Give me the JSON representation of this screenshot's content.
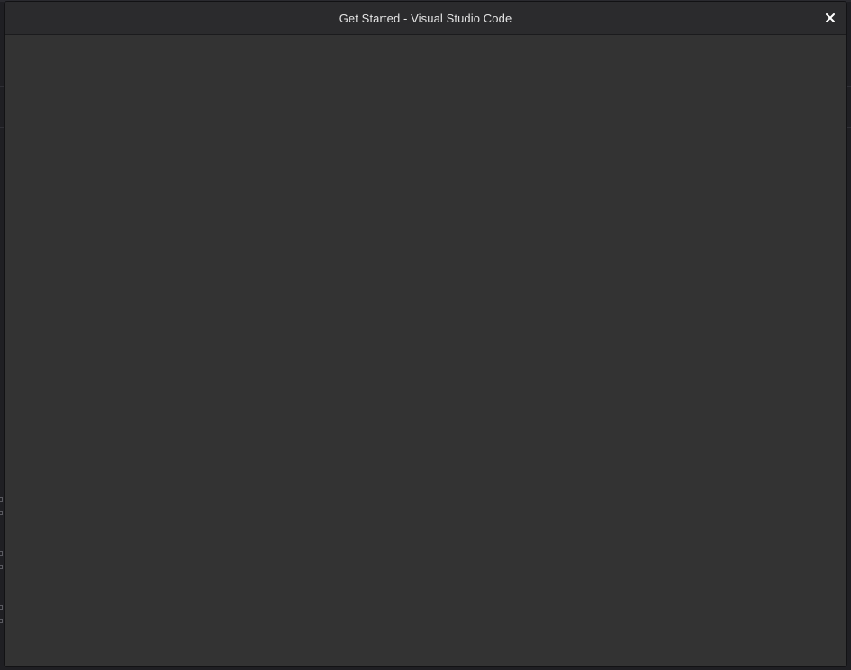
{
  "window": {
    "title": "Get Started - Visual Studio Code",
    "close_icon": "close-icon"
  },
  "colors": {
    "window_bg": "#333333",
    "titlebar_bg": "#2b2b2d",
    "title_text": "#e6e6e6"
  }
}
